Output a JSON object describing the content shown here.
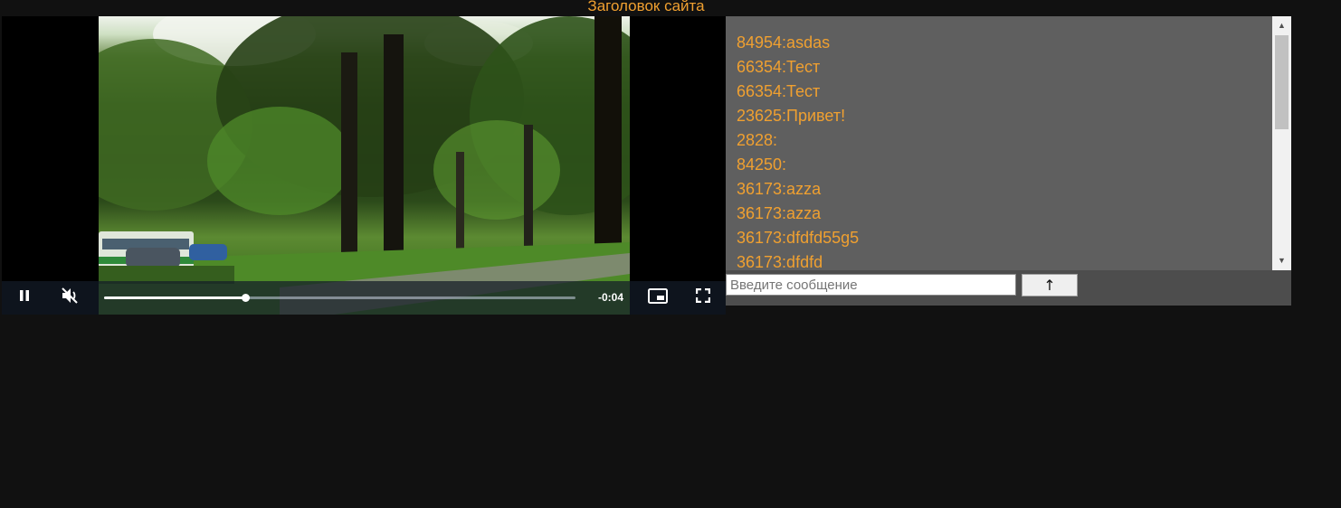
{
  "site": {
    "title": "Заголовок сайта"
  },
  "player": {
    "state": "playing",
    "muted": true,
    "time_remaining": "-0:04",
    "progress_fraction": 0.3,
    "icons": {
      "pause": "pause-icon",
      "mute": "volume-muted-icon",
      "pip": "picture-in-picture-icon",
      "fullscreen": "fullscreen-icon"
    },
    "scene": "park-with-trees-and-bus"
  },
  "chat": {
    "messages": [
      {
        "text": "84954:asdas"
      },
      {
        "text": "66354:Тест"
      },
      {
        "text": "66354:Тест"
      },
      {
        "text": "23625:Привет!"
      },
      {
        "text": "2828:"
      },
      {
        "text": "84250:"
      },
      {
        "text": "36173:azza"
      },
      {
        "text": "36173:azza"
      },
      {
        "text": "36173:dfdfd55g5"
      },
      {
        "text": "36173:dfdfd"
      }
    ],
    "input": {
      "value": "",
      "placeholder": "Введите сообщение"
    },
    "send_label": "↑",
    "scroll_up_glyph": "▲",
    "scroll_down_glyph": "▼"
  },
  "colors": {
    "accent": "#f0a030",
    "page_background": "#111111",
    "chat_background": "#5f5f5f",
    "chat_footer": "#4d4d4d"
  }
}
